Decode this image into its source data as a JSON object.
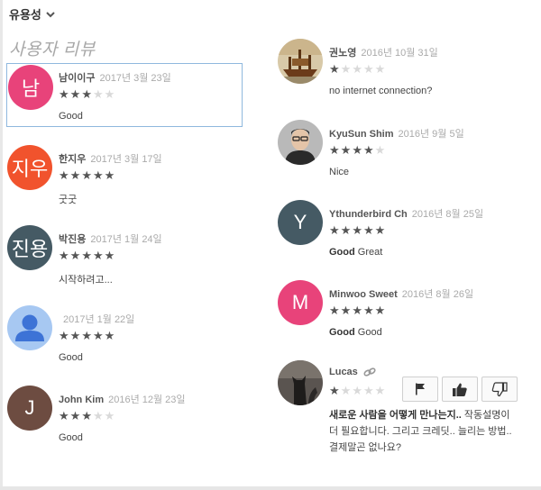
{
  "sort": {
    "label": "유용성"
  },
  "section_title": "사용자 리뷰",
  "reviews_left": [
    {
      "author": "남이이구",
      "date": "2017년 3월 23일",
      "rating": 3,
      "text": "Good",
      "avatar_text": "남",
      "avatar_color": "#e8437a"
    },
    {
      "author": "한지우",
      "date": "2017년 3월 17일",
      "rating": 5,
      "text": "굿굿",
      "avatar_text": "지우",
      "avatar_color": "#f1532d"
    },
    {
      "author": "박진용",
      "date": "2017년 1월 24일",
      "rating": 5,
      "text": "시작하려고...",
      "avatar_text": "진용",
      "avatar_color": "#455a64"
    },
    {
      "author": "",
      "date": "2017년 1월 22일",
      "rating": 5,
      "text": "Good",
      "avatar_text": "",
      "avatar_color": "#a7c8f2"
    },
    {
      "author": "John Kim",
      "date": "2016년 12월 23일",
      "rating": 3,
      "text": "Good",
      "avatar_text": "J",
      "avatar_color": "#6d4c41"
    }
  ],
  "reviews_right": [
    {
      "author": "권노영",
      "date": "2016년 10월 31일",
      "rating": 1,
      "text": "no internet connection?"
    },
    {
      "author": "KyuSun Shim",
      "date": "2016년 9월 5일",
      "rating": 4,
      "text": "Nice"
    },
    {
      "author": "Ythunderbird Ch",
      "date": "2016년 8월 25일",
      "rating": 5,
      "title": "Good",
      "text": "Great",
      "avatar_text": "Y",
      "avatar_color": "#455a64"
    },
    {
      "author": "Minwoo Sweet",
      "date": "2016년 8월 26일",
      "rating": 5,
      "title": "Good",
      "text": "Good",
      "avatar_text": "M",
      "avatar_color": "#e8437a"
    },
    {
      "author": "Lucas",
      "date": "",
      "rating": 1,
      "title": "새로운 사람을 어떻게 만나는지..",
      "text": "작동설명이 더 필요합니다. 그리고 크레딧.. 늘리는 방법.. 결제말곤 없나요?"
    }
  ],
  "icons": {
    "sort": "chevron-down-icon",
    "link": "link-icon",
    "flag": "flag-icon",
    "like": "thumbs-up-icon",
    "dislike": "thumbs-down-icon"
  }
}
